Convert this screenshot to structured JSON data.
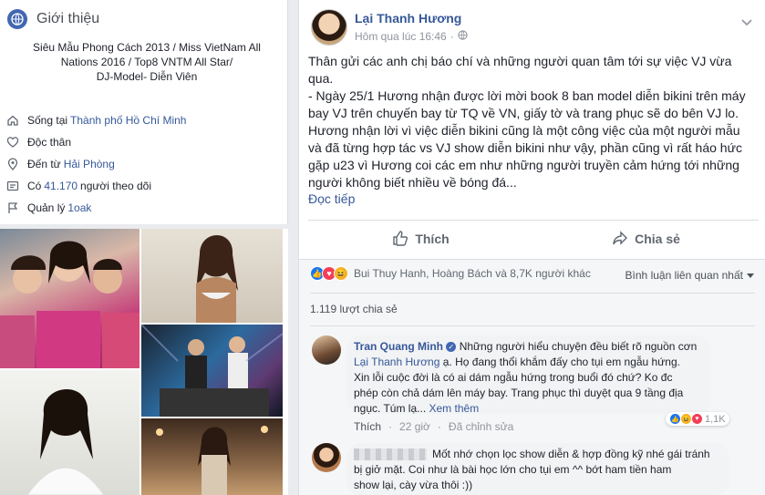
{
  "intro": {
    "title": "Giới thiệu",
    "bio_line1": "Siêu Mẫu Phong Cách 2013 / Miss VietNam All",
    "bio_line2": "Nations 2016 / Top8 VNTM All Star/",
    "bio_line3": "DJ-Model- Diễn Viên",
    "lives_prefix": "Sống tại",
    "lives_city": "Thành phố Hồ Chí Minh",
    "relationship": "Độc thân",
    "from_prefix": "Đến từ",
    "from_city": "Hải Phòng",
    "followers_prefix": "Có",
    "followers_count": "41.170",
    "followers_suffix": "người theo dõi",
    "manager_prefix": "Quản lý",
    "manager_name": "1oak"
  },
  "post": {
    "author": "Lại Thanh Hương",
    "time": "Hôm qua lúc 16:46",
    "body_line1": "Thân gửi các anh chị báo chí và những người quan tâm tới sự việc VJ vừa",
    "body_line2": "qua.",
    "body_line3": "- Ngày 25/1 Hương nhận được lời mời book 8 ban model diễn bikini trên máy",
    "body_line4": "bay VJ trên chuyến bay từ TQ về VN, giấy tờ và trang phục sẽ do bên VJ lo.",
    "body_line5": "Hương nhận lời vì việc diễn bikini cũng là một công việc của một người mẫu",
    "body_line6": "và đã từng hợp tác vs VJ show diễn bikini như vậy, phần cũng vì rất háo hức",
    "body_line7": "gặp u23 vì Hương coi các em như những người truyền cảm hứng tới những",
    "body_line8": "người không biết nhiều về bóng đá...",
    "read_more": "Đọc tiếp",
    "like_label": "Thích",
    "share_label": "Chia sẻ",
    "reactors": "Bui Thuy Hanh, Hoàng Bách và 8,7K người khác",
    "sort_label": "Bình luận liên quan nhất",
    "shares": "1.119 lượt chia sẻ"
  },
  "comments": [
    {
      "name": "Tran Quang Minh",
      "text_a": "Những người hiểu chuyện đều biết rõ nguồn cơn",
      "mention": "Lại Thanh Hương",
      "text_b": "ạ. Họ đang thổi khắm đấy cho tụi em ngẫu hứng.",
      "text_c": "Xin lỗi cuộc đời là có ai dám ngẫu hứng trong buổi đó chứ? Ko đc",
      "text_d": "phép còn chả dám lên máy bay. Trang phục thì duyệt qua 9 tầng địa",
      "text_e": "ngục. Túm lạ...",
      "see_more": "Xem thêm",
      "like": "Thích",
      "time": "22 giờ",
      "edited": "Đã chỉnh sửa",
      "reactions": "1,1K"
    },
    {
      "text_a": "Mốt nhớ chọn lọc show diễn & hợp đồng kỹ nhé gái tránh",
      "text_b": "bị giở mặt. Coi như là bài học lớn cho tụi em ^^ bớt ham tiền ham",
      "text_c": "show lại, cày vừa thôi :))"
    }
  ],
  "colors": {
    "brand": "#4267b2",
    "link": "#365899",
    "like": "#1877f2",
    "love": "#f33e58",
    "haha": "#f7b125"
  }
}
